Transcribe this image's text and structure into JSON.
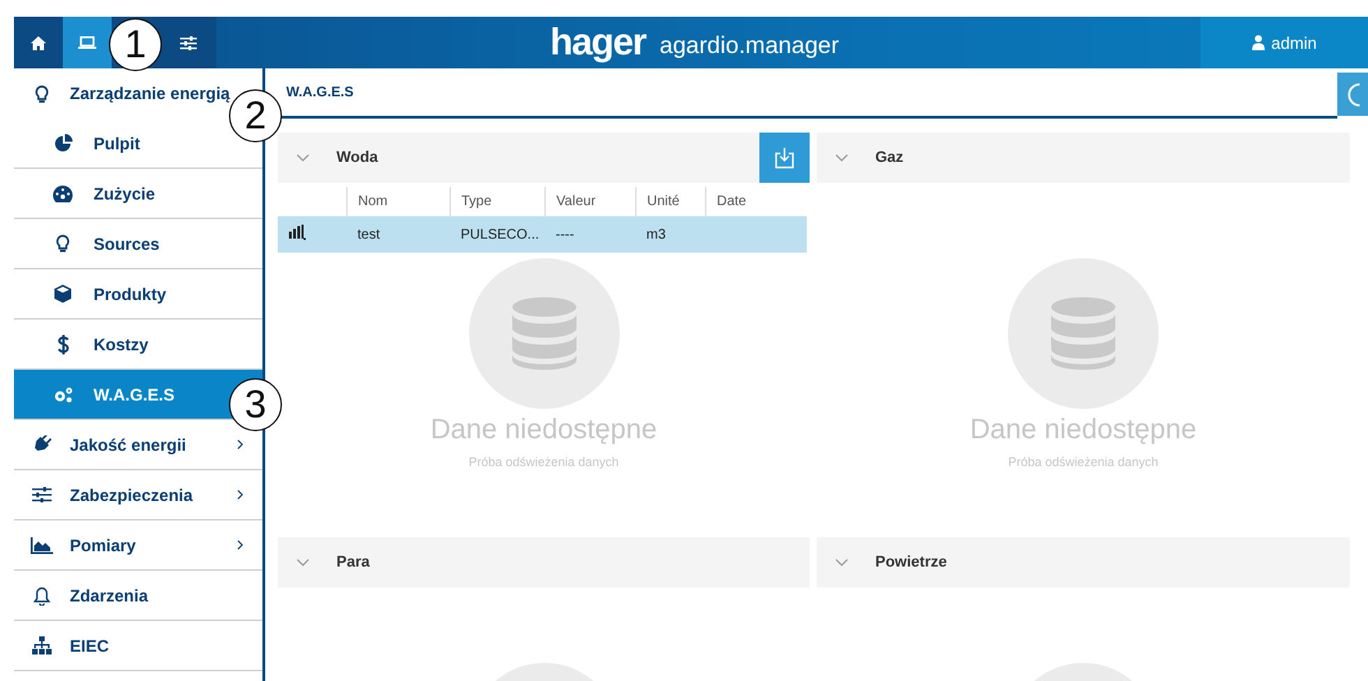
{
  "header": {
    "nav_buttons": [
      {
        "selected": false
      },
      {
        "selected": true
      },
      {
        "selected": false
      }
    ],
    "logo": {
      "brand": "hager",
      "product": "agardio.manager"
    },
    "user": "admin"
  },
  "sidebar": {
    "items": [
      {
        "label": "Zarządzanie energią",
        "kind": "group",
        "expanded": true,
        "children": [
          {
            "label": "Pulpit",
            "selected": false
          },
          {
            "label": "Zużycie",
            "selected": false
          },
          {
            "label": "Sources",
            "selected": false
          },
          {
            "label": "Produkty",
            "selected": false
          },
          {
            "label": "Kostzy",
            "selected": false
          },
          {
            "label": "W.A.G.E.S",
            "selected": true
          }
        ]
      },
      {
        "label": "Jakość energii",
        "kind": "group",
        "expanded": false
      },
      {
        "label": "Zabezpieczenia",
        "kind": "group",
        "expanded": false
      },
      {
        "label": "Pomiary",
        "kind": "group",
        "expanded": false
      },
      {
        "label": "Zdarzenia",
        "kind": "link"
      },
      {
        "label": "EIEC",
        "kind": "link"
      }
    ]
  },
  "breadcrumb": "W.A.G.E.S",
  "panels": [
    {
      "title": "Woda",
      "expanded": true,
      "export_button": true,
      "table": {
        "columns": [
          "Nom",
          "Type",
          "Valeur",
          "Unité",
          "Date"
        ],
        "rows": [
          {
            "selected": true,
            "cells": [
              "test",
              "PULSECO...",
              "----",
              "m3"
            ]
          }
        ]
      },
      "empty_state": {
        "title": "Dane niedostępne",
        "subtitle": "Próba odświeżenia danych"
      }
    },
    {
      "title": "Gaz",
      "expanded": true,
      "export_button": false,
      "empty_state": {
        "title": "Dane niedostępne",
        "subtitle": "Próba odświeżenia danych"
      }
    },
    {
      "title": "Para",
      "expanded": true,
      "export_button": false
    },
    {
      "title": "Powietrze",
      "expanded": true,
      "export_button": false
    }
  ],
  "callouts": [
    {
      "label": "1"
    },
    {
      "label": "2"
    },
    {
      "label": "3"
    }
  ]
}
